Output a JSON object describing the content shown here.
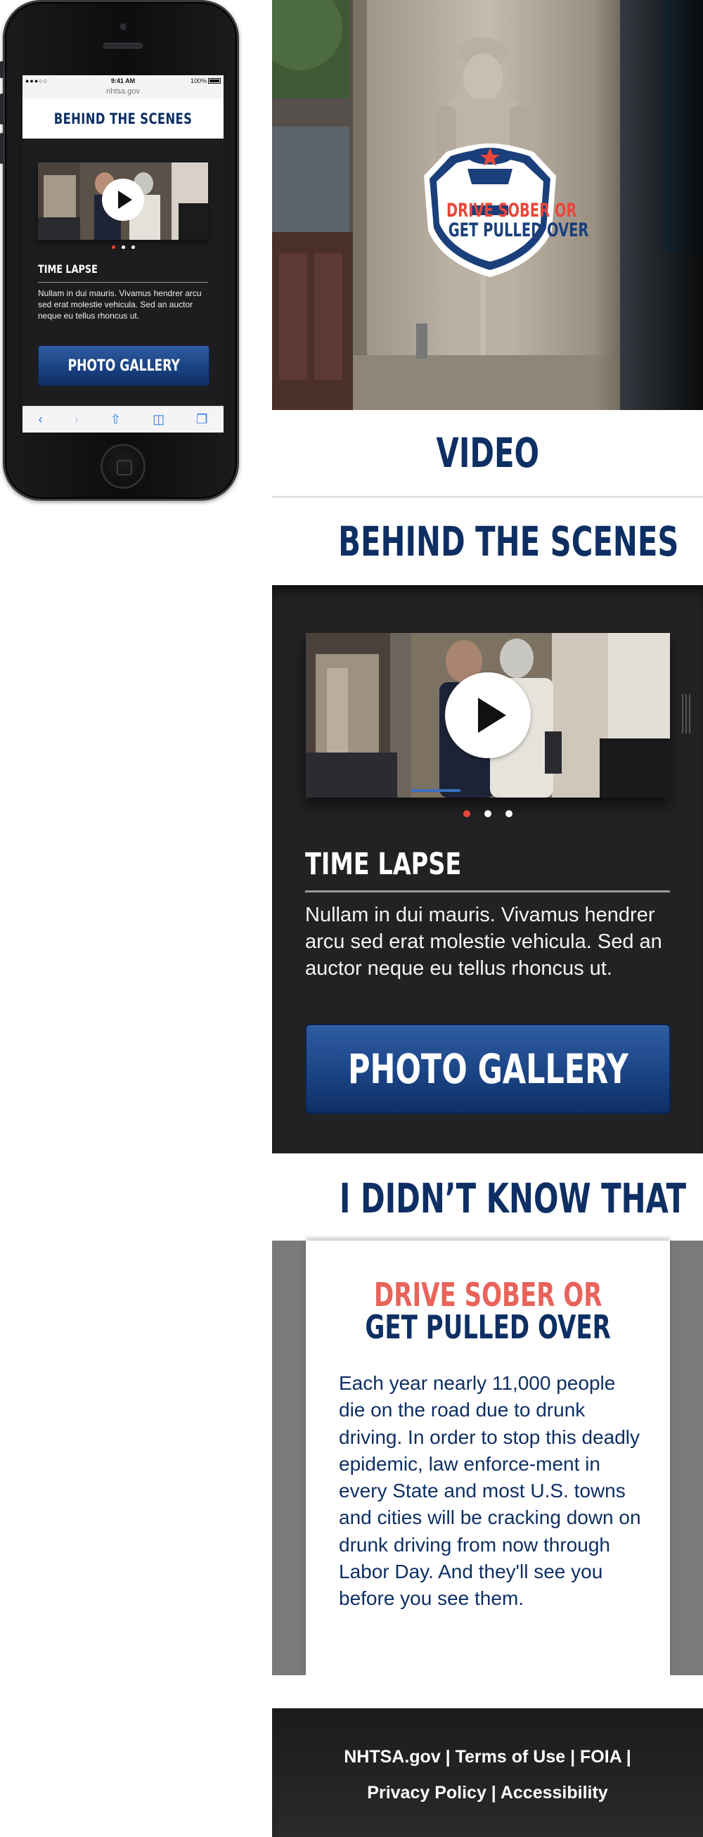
{
  "mobile": {
    "status": {
      "carrier": "●●●○○",
      "time": "9:41 AM",
      "battery": "100%",
      "url": "nhtsa.gov"
    },
    "header_title": "BEHIND THE SCENES",
    "slide": {
      "title": "TIME LAPSE",
      "body": "Nullam in dui mauris. Vivamus hendrer arcu sed erat molestie vehicula. Sed an auctor neque eu tellus rhoncus ut."
    },
    "gallery_button": "PHOTO GALLERY",
    "toolbar": {
      "back": "‹",
      "forward": "›",
      "share": "⇧",
      "bookmarks": "◫",
      "tabs": "❐"
    }
  },
  "hero": {
    "logo_line1": "DRIVE SOBER OR",
    "logo_line2": "GET PULLED OVER"
  },
  "sections": {
    "video_title": "VIDEO",
    "behind_title": "BEHIND THE SCENES",
    "didnt_know_title": "I DIDN’T KNOW THAT"
  },
  "slide": {
    "title": "TIME LAPSE",
    "body": "Nullam in dui mauris. Vivamus hendrer arcu sed erat molestie vehicula. Sed an auctor neque eu tellus rhoncus ut.",
    "dots_total": 3,
    "dots_active": 1
  },
  "gallery_button": "PHOTO GALLERY",
  "card": {
    "kicker": "DRIVE SOBER OR",
    "heading": "GET PULLED OVER",
    "body": "Each year nearly 11,000 people die on the road due to drunk driving. In order to stop this deadly epidemic, law enforce-ment in every State and most U.S. towns and cities will be cracking down on drunk driving from now through Labor Day. And they'll see you before you see them."
  },
  "footer": {
    "links": [
      "NHTSA.gov",
      "Terms of Use",
      "FOIA",
      "Privacy Policy",
      "Accessibility"
    ],
    "separator": " | "
  },
  "colors": {
    "navy": "#0e2f63",
    "red": "#e8463a",
    "coral": "#e8635a",
    "dark": "#222224",
    "gray": "#7a7a7a"
  }
}
